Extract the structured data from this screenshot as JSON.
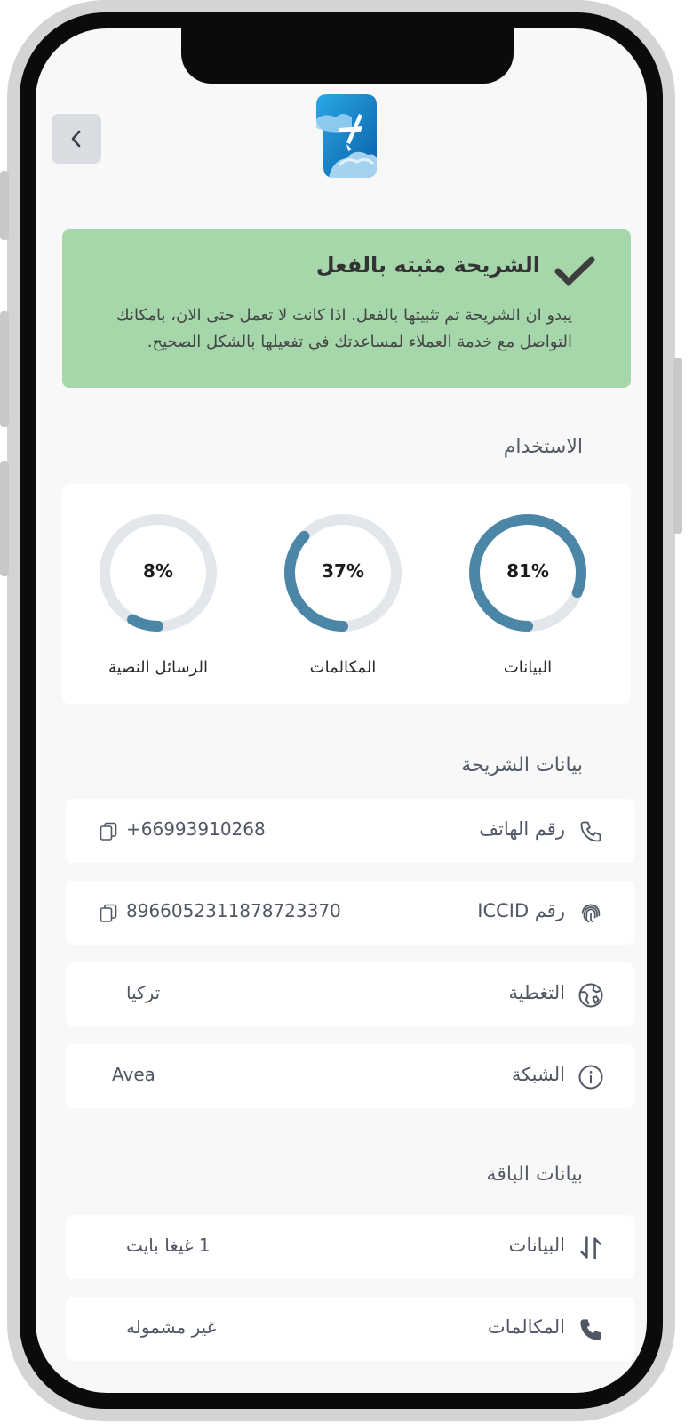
{
  "header": {
    "back_icon": "chevron-left-icon",
    "logo_icon": "airplane-logo-icon"
  },
  "alert": {
    "title": "الشريحة مثبته بالفعل",
    "icon": "checkmark-icon",
    "body": "يبدو ان الشريحة تم تثبيتها بالفعل. اذا كانت لا تعمل حتى الان، بامكانك التواصل مع خدمة العملاء لمساعدتك في تفعيلها بالشكل الصحيح."
  },
  "usage": {
    "title": "الاستخدام",
    "items": [
      {
        "label": "البيانات",
        "percent_text": "81%",
        "percent": 81
      },
      {
        "label": "المكالمات",
        "percent_text": "37%",
        "percent": 37
      },
      {
        "label": "الرسائل النصية",
        "percent_text": "8%",
        "percent": 8
      }
    ],
    "colors": {
      "track": "#e3e6ea",
      "fill": "#4c86a6"
    }
  },
  "sim": {
    "title": "بيانات الشريحة",
    "rows": [
      {
        "label": "رقم الهاتف",
        "value": "+66993910268",
        "icon": "phone-icon",
        "copyable": true
      },
      {
        "label": "رقم ICCID",
        "value": "8966052311878723370",
        "icon": "fingerprint-icon",
        "copyable": true
      },
      {
        "label": "التغطية",
        "value": "تركيا",
        "icon": "globe-icon",
        "copyable": false
      },
      {
        "label": "الشبكة",
        "value": "Avea",
        "icon": "info-icon",
        "copyable": false
      }
    ]
  },
  "package": {
    "title": "بيانات الباقة",
    "rows": [
      {
        "label": "البيانات",
        "value": "1 غيغا بايت",
        "icon": "data-transfer-icon"
      },
      {
        "label": "المكالمات",
        "value": "غير مشموله",
        "icon": "phone-filled-icon"
      }
    ]
  },
  "colors": {
    "alert_bg": "#a5d7aa",
    "screen_bg": "#f8f8f9",
    "accent": "#4c86a6"
  }
}
